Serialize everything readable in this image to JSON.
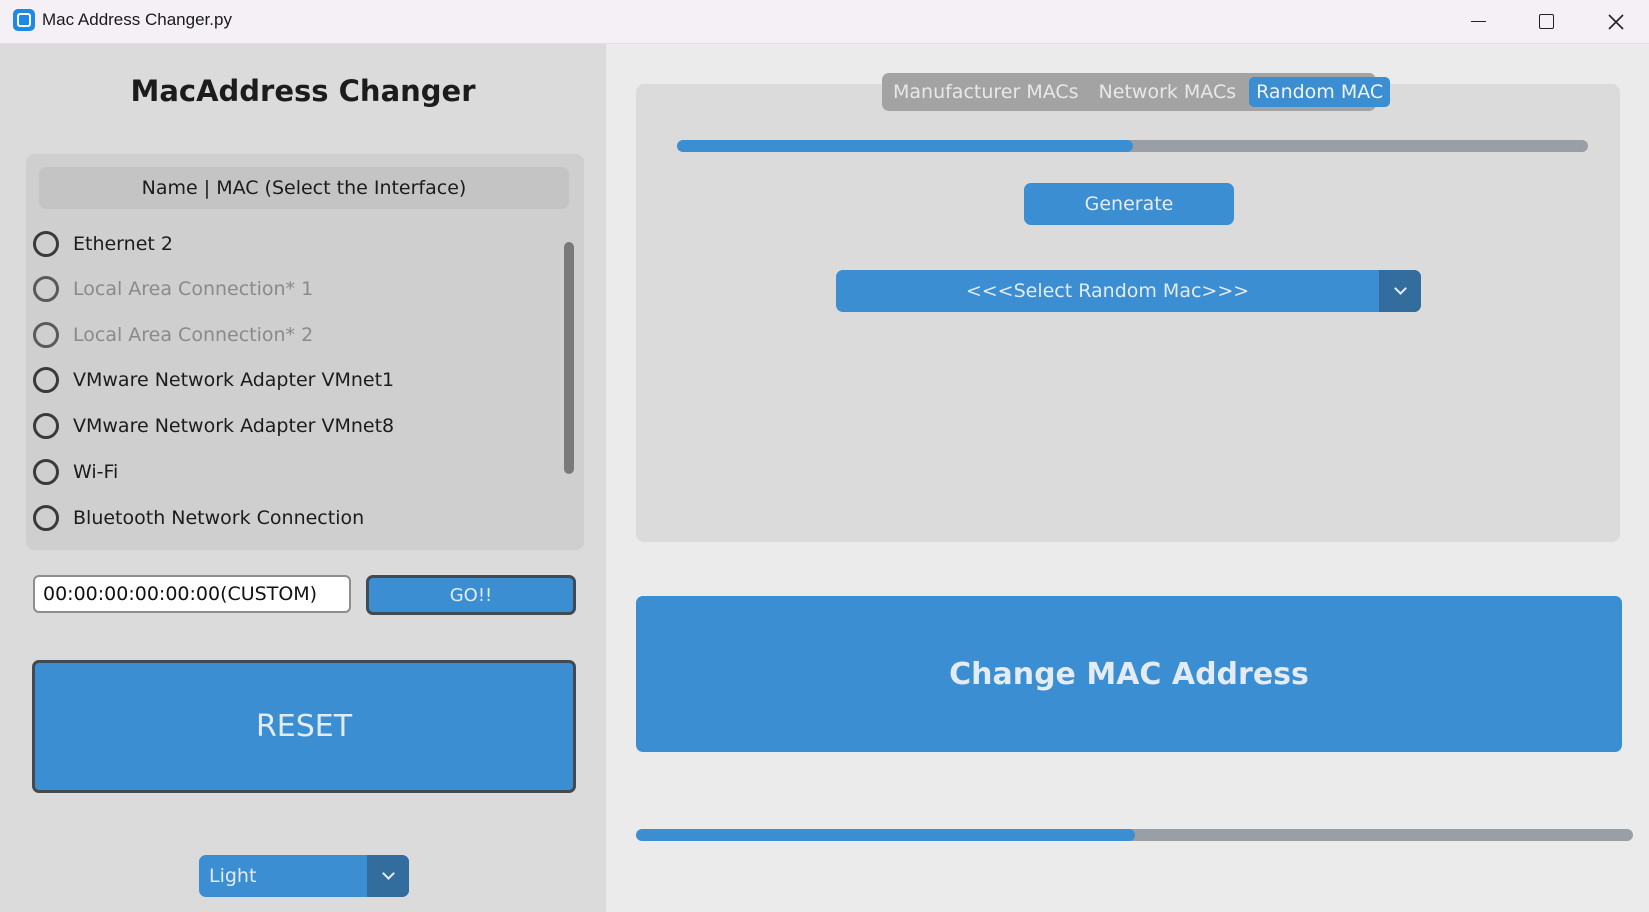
{
  "window": {
    "title": "Mac Address Changer.py"
  },
  "left": {
    "heading": "MacAddress Changer",
    "interfaces_header": "Name | MAC (Select the Interface)",
    "interfaces": [
      {
        "label": "Ethernet 2",
        "enabled": true
      },
      {
        "label": "Local Area Connection* 1",
        "enabled": false
      },
      {
        "label": "Local Area Connection* 2",
        "enabled": false
      },
      {
        "label": "VMware Network Adapter VMnet1",
        "enabled": true
      },
      {
        "label": "VMware Network Adapter VMnet8",
        "enabled": true
      },
      {
        "label": "Wi-Fi",
        "enabled": true
      },
      {
        "label": "Bluetooth Network Connection",
        "enabled": true
      }
    ],
    "custom_mac_value": "00:00:00:00:00:00(CUSTOM)",
    "go_label": "GO!!",
    "reset_label": "RESET",
    "theme_value": "Light"
  },
  "right": {
    "tabs": [
      {
        "label": "Manufacturer MACs",
        "active": false
      },
      {
        "label": "Network MACs",
        "active": false
      },
      {
        "label": "Random MAC",
        "active": true
      }
    ],
    "top_progress": 0.5,
    "generate_label": "Generate",
    "random_mac_select": "<<<Select Random Mac>>>",
    "change_label": "Change MAC Address",
    "bottom_progress": 0.5
  },
  "colors": {
    "accent": "#3a8ed1",
    "accent_dark": "#336d9e",
    "panel": "#dbdbdb"
  },
  "icons": [
    "app-icon",
    "minimize-icon",
    "maximize-icon",
    "close-icon",
    "chevron-down-icon"
  ]
}
